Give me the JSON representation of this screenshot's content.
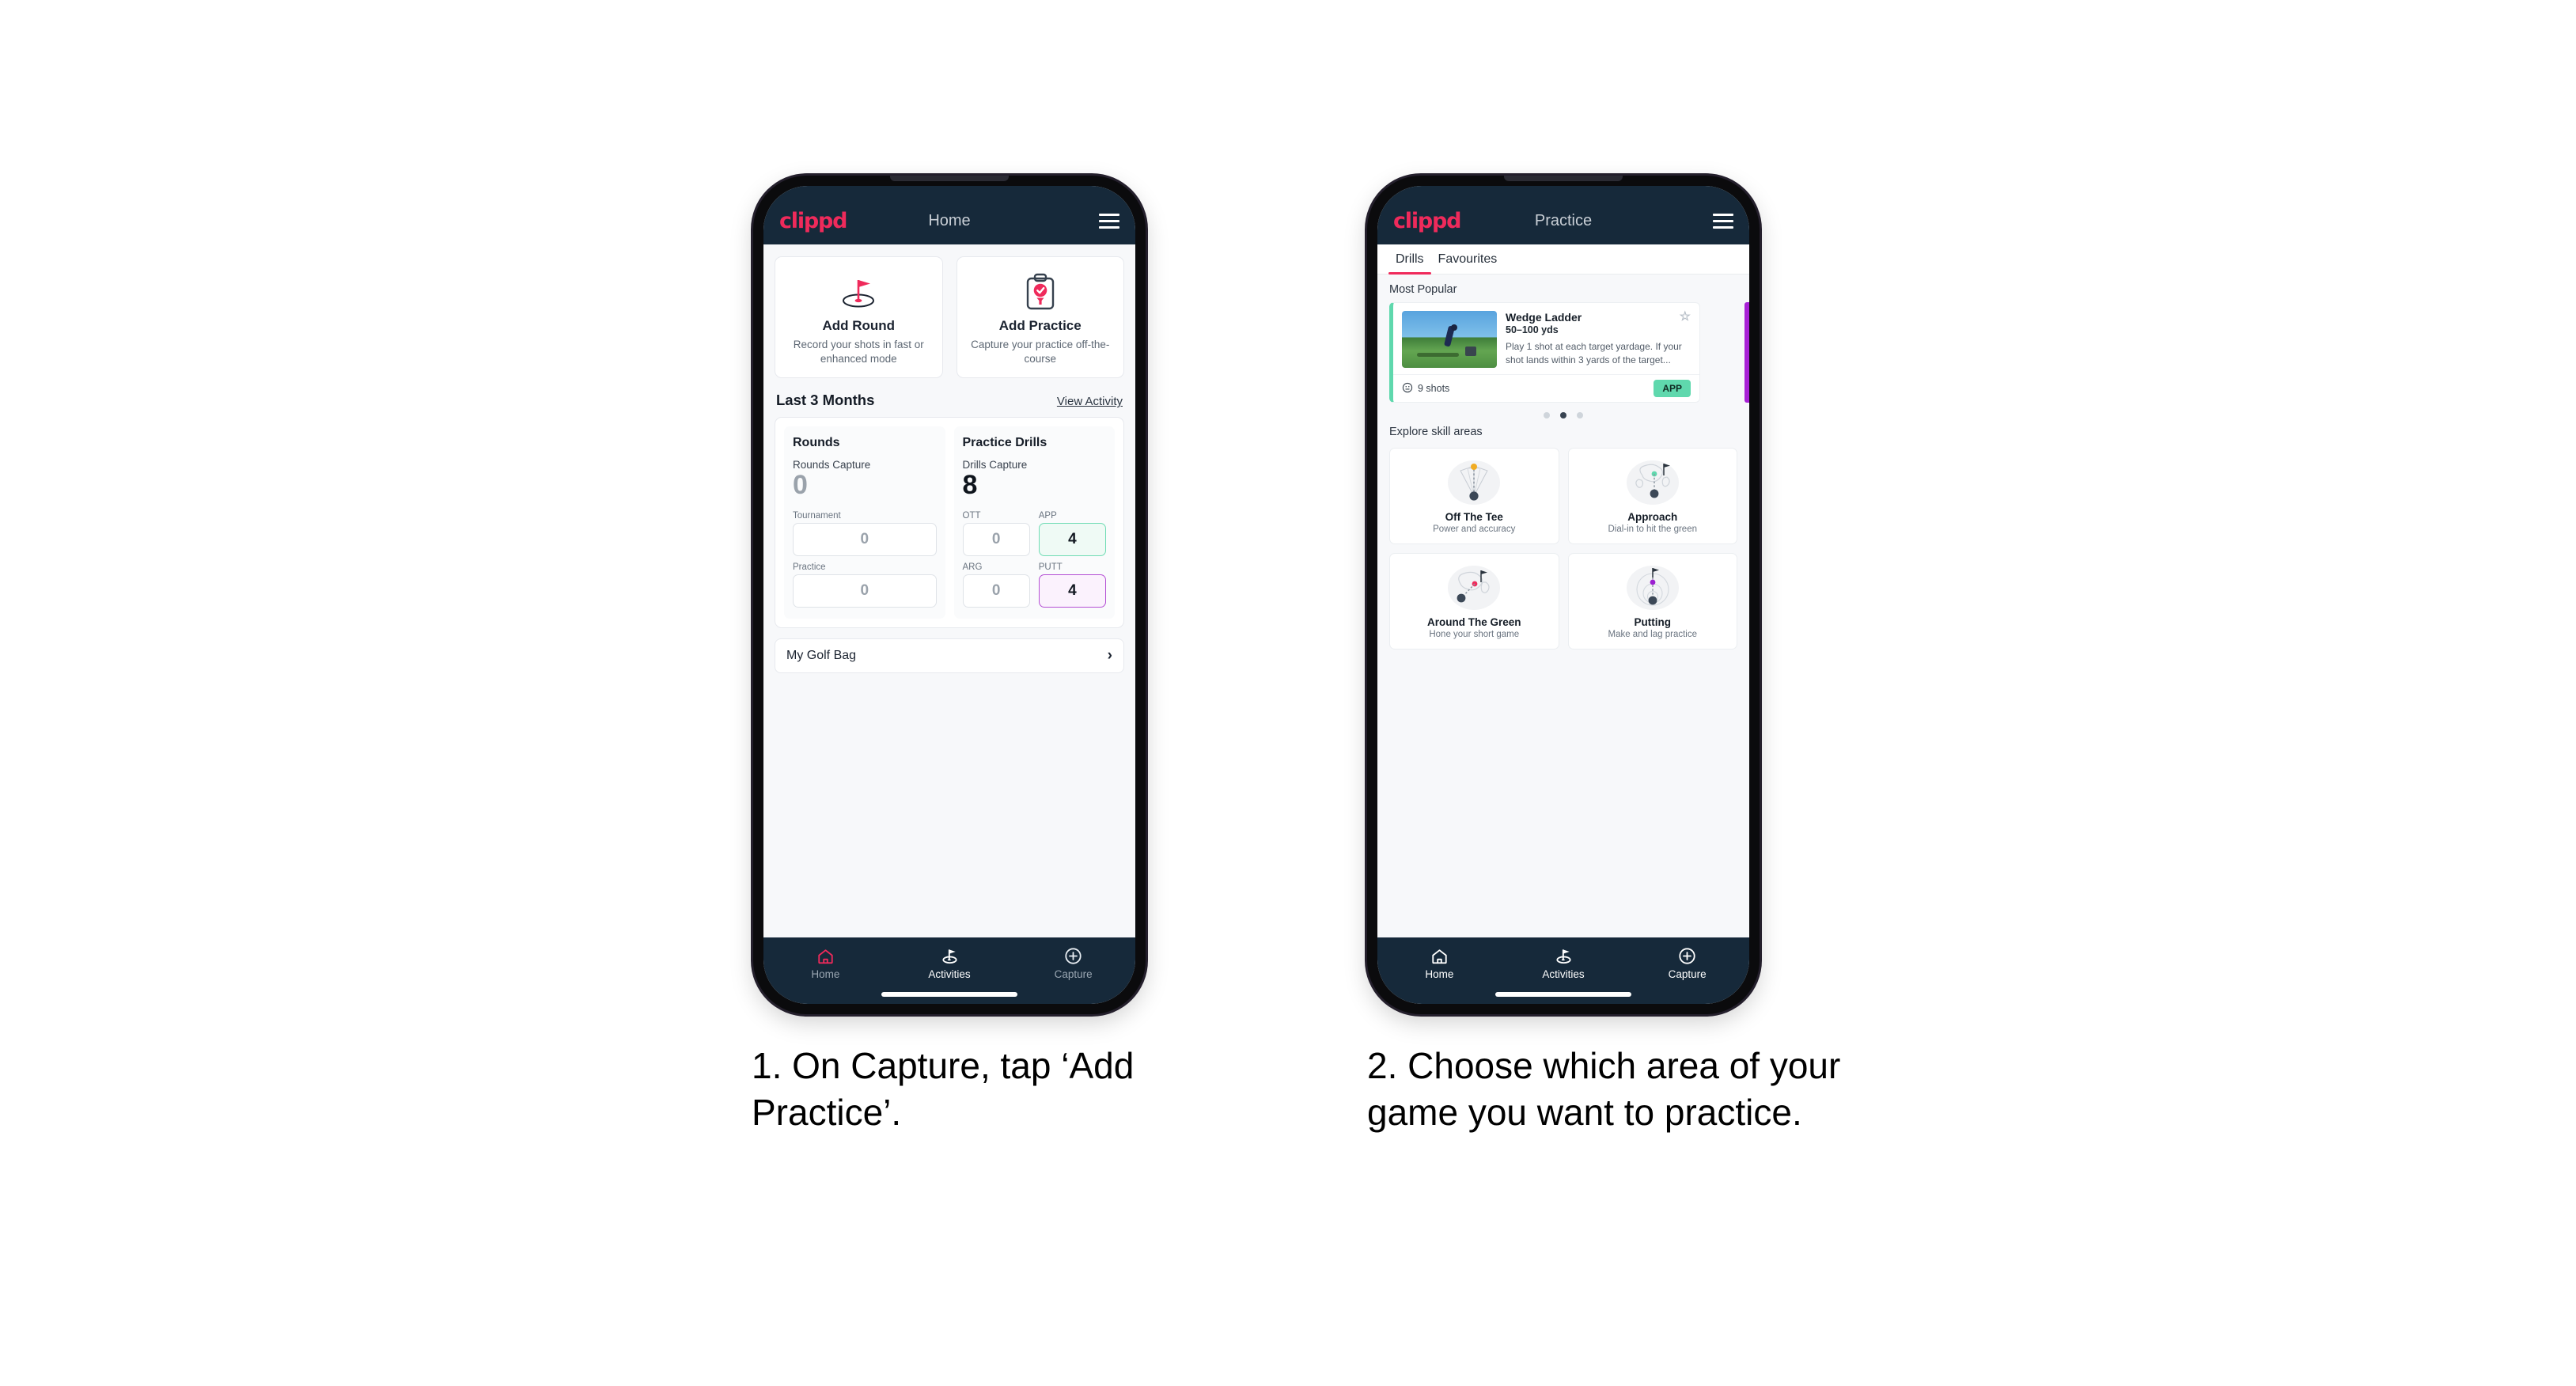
{
  "phone1": {
    "appbar": {
      "brand": "clippd",
      "title": "Home",
      "menu_icon": "hamburger-icon"
    },
    "quick_actions": [
      {
        "icon": "golf-flag-hole-icon",
        "title": "Add Round",
        "subtitle": "Record your shots in fast or enhanced mode"
      },
      {
        "icon": "clipboard-check-tee-icon",
        "title": "Add Practice",
        "subtitle": "Capture your practice off-the-course"
      }
    ],
    "section": {
      "title": "Last 3 Months",
      "link": "View Activity"
    },
    "rounds": {
      "heading": "Rounds",
      "capture_label": "Rounds Capture",
      "capture_value": "0",
      "items": [
        {
          "label": "Tournament",
          "value": "0"
        },
        {
          "label": "Practice",
          "value": "0"
        }
      ]
    },
    "drills": {
      "heading": "Practice Drills",
      "capture_label": "Drills Capture",
      "capture_value": "8",
      "items": [
        {
          "label": "OTT",
          "value": "0",
          "style": "plain"
        },
        {
          "label": "APP",
          "value": "4",
          "style": "app"
        },
        {
          "label": "ARG",
          "value": "0",
          "style": "plain"
        },
        {
          "label": "PUTT",
          "value": "4",
          "style": "putt"
        }
      ]
    },
    "golf_bag": {
      "label": "My Golf Bag",
      "chevron": "chevron-right-icon"
    },
    "nav": [
      {
        "icon": "home-icon",
        "label": "Home",
        "state": "dim-pink"
      },
      {
        "icon": "golf-flag-icon",
        "label": "Activities",
        "state": "bright"
      },
      {
        "icon": "plus-circle-icon",
        "label": "Capture",
        "state": "dim"
      }
    ]
  },
  "phone2": {
    "appbar": {
      "brand": "clippd",
      "title": "Practice",
      "menu_icon": "hamburger-icon"
    },
    "tabs": [
      {
        "label": "Drills",
        "active": true
      },
      {
        "label": "Favourites",
        "active": false
      }
    ],
    "most_popular": {
      "title": "Most Popular"
    },
    "drill_card": {
      "name": "Wedge Ladder",
      "yardage": "50–100 yds",
      "description": "Play 1 shot at each target yardage. If your shot lands within 3 yards of the target...",
      "shots": "9 shots",
      "shots_icon": "clock-icon",
      "badge": "APP",
      "star_icon": "star-outline-icon",
      "thumbnail": "golfer-chipping-photo"
    },
    "carousel_dots": [
      false,
      true,
      false
    ],
    "explore": {
      "title": "Explore skill areas"
    },
    "skills": [
      {
        "art": "off-the-tee-art",
        "name": "Off The Tee",
        "sub": "Power and accuracy"
      },
      {
        "art": "approach-art",
        "name": "Approach",
        "sub": "Dial-in to hit the green"
      },
      {
        "art": "around-the-green-art",
        "name": "Around The Green",
        "sub": "Hone your short game"
      },
      {
        "art": "putting-art",
        "name": "Putting",
        "sub": "Make and lag practice"
      }
    ],
    "nav": [
      {
        "icon": "home-icon",
        "label": "Home",
        "state": "bright"
      },
      {
        "icon": "golf-flag-icon",
        "label": "Activities",
        "state": "bright"
      },
      {
        "icon": "plus-circle-icon",
        "label": "Capture",
        "state": "bright"
      }
    ]
  },
  "captions": {
    "one": "1. On Capture, tap ‘Add Practice’.",
    "two": "2. Choose which area of your game you want to practice."
  },
  "colors": {
    "brand_pink": "#ef2a5b",
    "navy": "#16293a",
    "app_green": "#5fd8ad",
    "putt_purple": "#b44fd4",
    "peek_purple": "#a821d6",
    "page_bg": "#f7f8fa"
  }
}
